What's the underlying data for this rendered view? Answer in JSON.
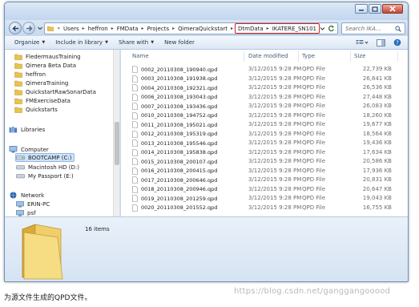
{
  "colors": {
    "window_border": "#6f8fb5",
    "chrome": "#c5d9ef",
    "highlight_box": "#d2232a",
    "folder_yellow": "#e7c44e",
    "selected_bg": "#cfe3fb",
    "network_blue": "#2b62b2"
  },
  "address_bar": {
    "crumbs": [
      "Users",
      "heffron",
      "FMData",
      "Projects",
      "QimeraQuickstart"
    ],
    "highlighted_crumbs": [
      "DtmData",
      "IKATERE_SN101"
    ],
    "overflow_icon": "double-chevron-left-icon"
  },
  "search": {
    "placeholder": "Search IKA..."
  },
  "toolbar": {
    "organize": "Organize",
    "include_in_library": "Include in library",
    "share_with": "Share with",
    "new_folder": "New folder"
  },
  "nav": {
    "favorites": [
      {
        "label": "FledermausTraining",
        "icon": "folder-icon"
      },
      {
        "label": "Qimera Beta Data",
        "icon": "folder-icon"
      },
      {
        "label": "heffron",
        "icon": "folder-icon"
      },
      {
        "label": "QimeraTraining",
        "icon": "folder-icon"
      },
      {
        "label": "QuickstartRawSonarData",
        "icon": "folder-icon"
      },
      {
        "label": "FMExerciseData",
        "icon": "folder-icon"
      },
      {
        "label": "Quickstarts",
        "icon": "folder-icon"
      }
    ],
    "libraries": {
      "label": "Libraries",
      "icon": "library-icon"
    },
    "computer": {
      "label": "Computer",
      "icon": "computer-icon",
      "drives": [
        {
          "label": "BOOTCAMP (C:)",
          "icon": "drive-icon",
          "selected": true
        },
        {
          "label": "Macintosh HD (D:)",
          "icon": "drive-icon",
          "selected": false
        },
        {
          "label": "My Passport (E:)",
          "icon": "drive-icon",
          "selected": false
        }
      ]
    },
    "network": {
      "label": "Network",
      "icon": "network-icon",
      "items": [
        {
          "label": "ERIN-PC",
          "icon": "computer-icon"
        },
        {
          "label": "psf",
          "icon": "computer-icon"
        }
      ]
    }
  },
  "columns": {
    "name": "Name",
    "date": "Date modified",
    "type": "Type",
    "size": "Size"
  },
  "files": [
    {
      "name": "0002_20110308_190940.qpd",
      "date": "3/12/2015 9:28 PM",
      "type": "QPD File",
      "size": "22,739 KB"
    },
    {
      "name": "0003_20110308_191938.qpd",
      "date": "3/12/2015 9:28 PM",
      "type": "QPD File",
      "size": "26,641 KB"
    },
    {
      "name": "0004_20110308_192321.qpd",
      "date": "3/12/2015 9:28 PM",
      "type": "QPD File",
      "size": "26,536 KB"
    },
    {
      "name": "0006_20110308_193043.qpd",
      "date": "3/12/2015 9:28 PM",
      "type": "QPD File",
      "size": "27,448 KB"
    },
    {
      "name": "0007_20110308_193436.qpd",
      "date": "3/12/2015 9:28 PM",
      "type": "QPD File",
      "size": "26,083 KB"
    },
    {
      "name": "0010_20110308_194752.qpd",
      "date": "3/12/2015 9:28 PM",
      "type": "QPD File",
      "size": "18,260 KB"
    },
    {
      "name": "0011_20110308_195021.qpd",
      "date": "3/12/2015 9:28 PM",
      "type": "QPD File",
      "size": "19,677 KB"
    },
    {
      "name": "0012_20110308_195319.qpd",
      "date": "3/12/2015 9:28 PM",
      "type": "QPD File",
      "size": "18,564 KB"
    },
    {
      "name": "0013_20110308_195546.qpd",
      "date": "3/12/2015 9:28 PM",
      "type": "QPD File",
      "size": "19,436 KB"
    },
    {
      "name": "0014_20110308_195838.qpd",
      "date": "3/12/2015 9:28 PM",
      "type": "QPD File",
      "size": "17,634 KB"
    },
    {
      "name": "0015_20110308_200107.qpd",
      "date": "3/12/2015 9:28 PM",
      "type": "QPD File",
      "size": "20,586 KB"
    },
    {
      "name": "0016_20110308_200415.qpd",
      "date": "3/12/2015 9:28 PM",
      "type": "QPD File",
      "size": "17,936 KB"
    },
    {
      "name": "0017_20110308_200646.qpd",
      "date": "3/12/2015 9:28 PM",
      "type": "QPD File",
      "size": "20,831 KB"
    },
    {
      "name": "0018_20110308_200946.qpd",
      "date": "3/12/2015 9:28 PM",
      "type": "QPD File",
      "size": "20,647 KB"
    },
    {
      "name": "0019_20110308_201259.qpd",
      "date": "3/12/2015 9:28 PM",
      "type": "QPD File",
      "size": "19,043 KB"
    },
    {
      "name": "0020_20110308_201552.qpd",
      "date": "3/12/2015 9:28 PM",
      "type": "QPD File",
      "size": "16,755 KB"
    }
  ],
  "details": {
    "item_count": "16 items",
    "icon": "folder-icon"
  },
  "caption": "为源文件生成的QPD文件。",
  "watermark": "https://blog.csdn.net/ganggangooood"
}
